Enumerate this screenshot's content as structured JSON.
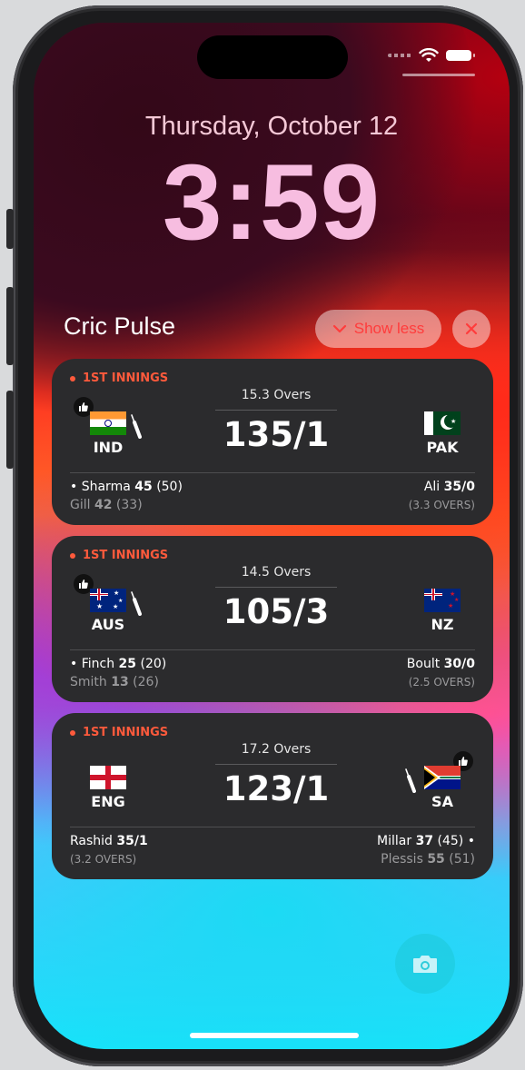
{
  "lockscreen": {
    "date": "Thursday, October 12",
    "time": "3:59"
  },
  "widget": {
    "app_name": "Cric Pulse",
    "show_less_label": "Show less",
    "close_icon": "x-icon"
  },
  "matches": [
    {
      "innings_label": "1ST INNINGS",
      "overs": "15.3 Overs",
      "score": "135/1",
      "left_team": "IND",
      "right_team": "PAK",
      "batting_side": "left",
      "batters": [
        {
          "bullet": "•",
          "name": "Sharma",
          "runs": "45",
          "balls": "(50)"
        },
        {
          "name": "Gill",
          "runs": "42",
          "balls": "(33)"
        }
      ],
      "bowler": {
        "name": "Ali",
        "figures": "35/0",
        "overs": "(3.3 OVERS)"
      }
    },
    {
      "innings_label": "1ST INNINGS",
      "overs": "14.5 Overs",
      "score": "105/3",
      "left_team": "AUS",
      "right_team": "NZ",
      "batting_side": "left",
      "batters": [
        {
          "bullet": "•",
          "name": "Finch",
          "runs": "25",
          "balls": "(20)"
        },
        {
          "name": "Smith",
          "runs": "13",
          "balls": "(26)"
        }
      ],
      "bowler": {
        "name": "Boult",
        "figures": "30/0",
        "overs": "(2.5 OVERS)"
      }
    },
    {
      "innings_label": "1ST INNINGS",
      "overs": "17.2 Overs",
      "score": "123/1",
      "left_team": "ENG",
      "right_team": "SA",
      "batting_side": "right",
      "bowler": {
        "name": "Rashid",
        "figures": "35/1",
        "overs": "(3.2 OVERS)"
      },
      "batters": [
        {
          "bullet": "•",
          "name": "Millar",
          "runs": "37",
          "balls": "(45)"
        },
        {
          "name": "Plessis",
          "runs": "55",
          "balls": "(51)"
        }
      ]
    }
  ],
  "colors": {
    "accent": "#ff3c3c",
    "innings": "#ff5a3c",
    "card_bg": "#2b2b2d"
  },
  "icons": {
    "camera": "camera-icon",
    "wifi": "wifi-icon",
    "battery": "battery-icon",
    "chevron": "chevron-down-icon",
    "thumbs_up": "thumbs-up-icon",
    "bat": "cricket-bat-icon"
  }
}
